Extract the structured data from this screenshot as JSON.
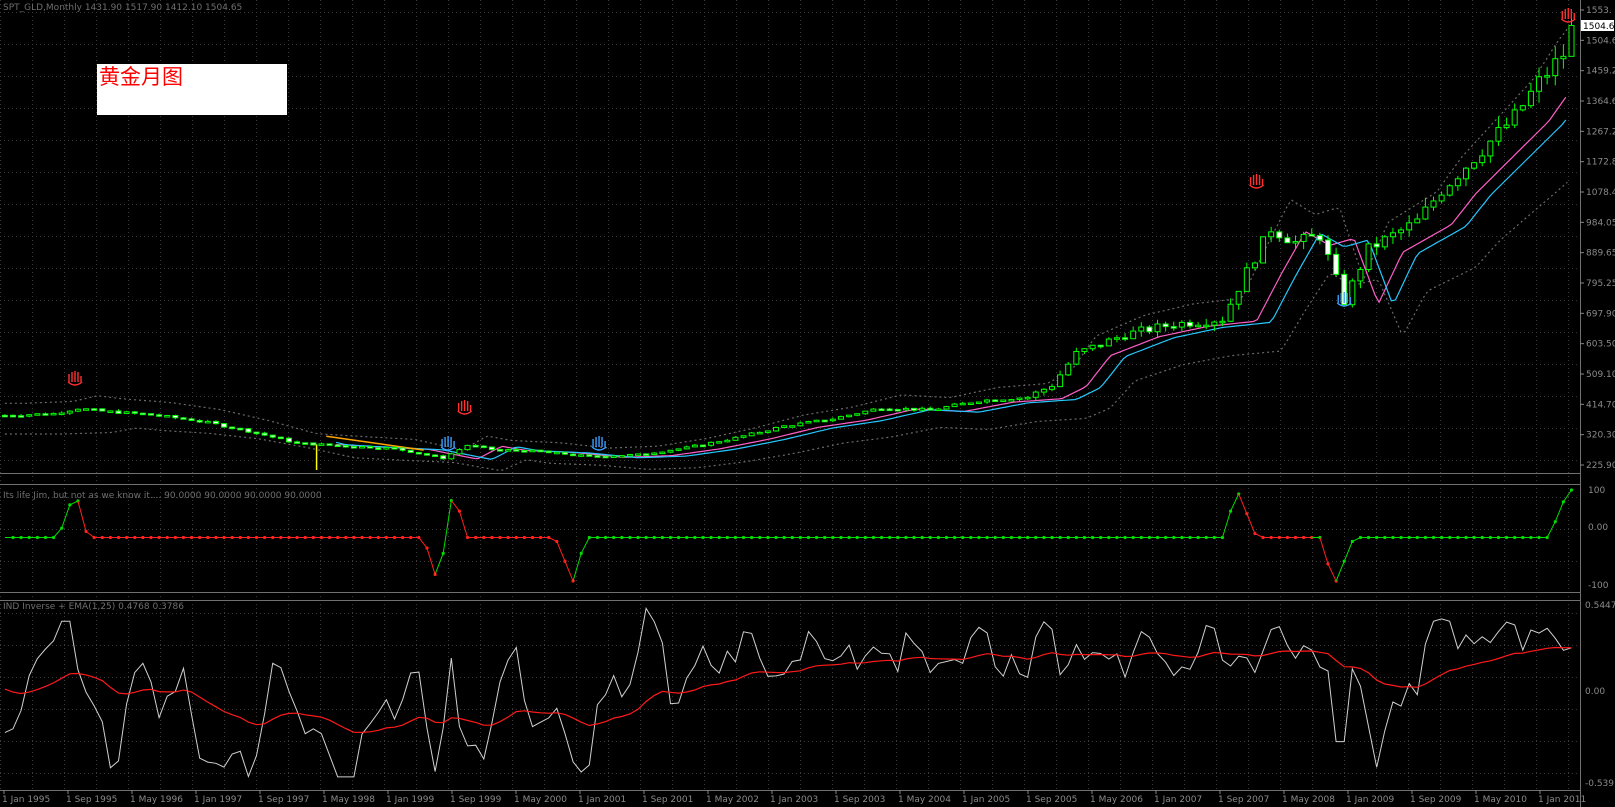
{
  "window": {
    "symbol_header": "SPT_GLD,Monthly  1431.90 1517.90 1412.10 1504.65"
  },
  "annotation": {
    "text": "黄金月图",
    "text_color": "#ff0000",
    "box_color": "#ffffff"
  },
  "panels": {
    "price": {
      "axis_labels": [
        "1553.",
        "1504.6",
        "1459.20",
        "1364.60",
        "1267.20",
        "1172.80",
        "1078.40",
        "984.05",
        "889.65",
        "795.25",
        "697.90",
        "603.50",
        "509.10",
        "414.70",
        "320.30",
        "225.90"
      ],
      "current_price_label": "1504.6"
    },
    "indicator1": {
      "title": "Its life Jim, but not as we know it....  90.0000 90.0000 90.0000 90.0000",
      "axis_labels": [
        "100",
        "0.00",
        "-100"
      ]
    },
    "indicator2": {
      "title": "IND Inverse + EMA(1,25)  0.4768 0.3786",
      "axis_labels": [
        "0.5447",
        "0.00",
        "-0.5391"
      ]
    }
  },
  "time_axis": {
    "labels": [
      "1 Jan 1995",
      "1 Sep 1995",
      "1 May 1996",
      "1 Jan 1997",
      "1 Sep 1997",
      "1 May 1998",
      "1 Jan 1999",
      "1 Sep 1999",
      "1 May 2000",
      "1 Jan 2001",
      "1 Sep 2001",
      "1 May 2002",
      "1 Jan 2003",
      "1 Sep 2003",
      "1 May 2004",
      "1 Jan 2005",
      "1 Sep 2005",
      "1 May 2006",
      "1 Jan 2007",
      "1 Sep 2007",
      "1 May 2008",
      "1 Jan 2009",
      "1 Sep 2009",
      "1 May 2010",
      "1 Jan 2011"
    ]
  },
  "colors": {
    "background": "#000000",
    "grid": "#3a3a3a",
    "bull_candle": "#00ff00",
    "bear_fill": "#ffffff",
    "ma_pink": "#ff5ec8",
    "ma_cyan": "#25c8ff",
    "band": "#6a6a6a",
    "ind1_up": "#00dd00",
    "ind1_down": "#ff2020",
    "ind2_line": "#d0d0d0",
    "ind2_ema": "#ff1a1a",
    "fractal_up_icon": "#ff3030",
    "fractal_down_icon": "#3aa0ff"
  },
  "chart_data": {
    "type": "candlestick",
    "period": "Monthly",
    "x_range": [
      "1995-01",
      "2011-02"
    ],
    "price_ylim": [
      225.9,
      1553
    ],
    "price_close_points": [
      [
        1995.0,
        383
      ],
      [
        1995.5,
        388
      ],
      [
        1995.75,
        403
      ],
      [
        1996.0,
        395
      ],
      [
        1996.5,
        385
      ],
      [
        1997.0,
        367
      ],
      [
        1997.5,
        338
      ],
      [
        1998.0,
        303
      ],
      [
        1998.5,
        295
      ],
      [
        1999.0,
        288
      ],
      [
        1999.5,
        260
      ],
      [
        1999.75,
        297
      ],
      [
        2000.0,
        285
      ],
      [
        2000.5,
        279
      ],
      [
        2001.0,
        265
      ],
      [
        2001.5,
        270
      ],
      [
        2002.0,
        290
      ],
      [
        2002.5,
        318
      ],
      [
        2003.0,
        352
      ],
      [
        2003.5,
        373
      ],
      [
        2004.0,
        405
      ],
      [
        2004.5,
        398
      ],
      [
        2005.0,
        425
      ],
      [
        2005.5,
        435
      ],
      [
        2005.75,
        470
      ],
      [
        2006.0,
        560
      ],
      [
        2006.5,
        615
      ],
      [
        2007.0,
        645
      ],
      [
        2007.5,
        660
      ],
      [
        2007.75,
        795
      ],
      [
        2008.0,
        920
      ],
      [
        2008.25,
        880
      ],
      [
        2008.5,
        900
      ],
      [
        2008.75,
        710
      ],
      [
        2009.0,
        860
      ],
      [
        2009.5,
        940
      ],
      [
        2009.75,
        1030
      ],
      [
        2010.0,
        1100
      ],
      [
        2010.5,
        1240
      ],
      [
        2010.75,
        1340
      ],
      [
        2011.0,
        1420
      ],
      [
        2011.1,
        1504.65
      ]
    ],
    "indicator1_levels": [
      100,
      0,
      -100
    ],
    "indicator2_ylim": [
      -0.5391,
      0.5447
    ],
    "indicator2_last": [
      0.4768,
      0.3786
    ]
  }
}
